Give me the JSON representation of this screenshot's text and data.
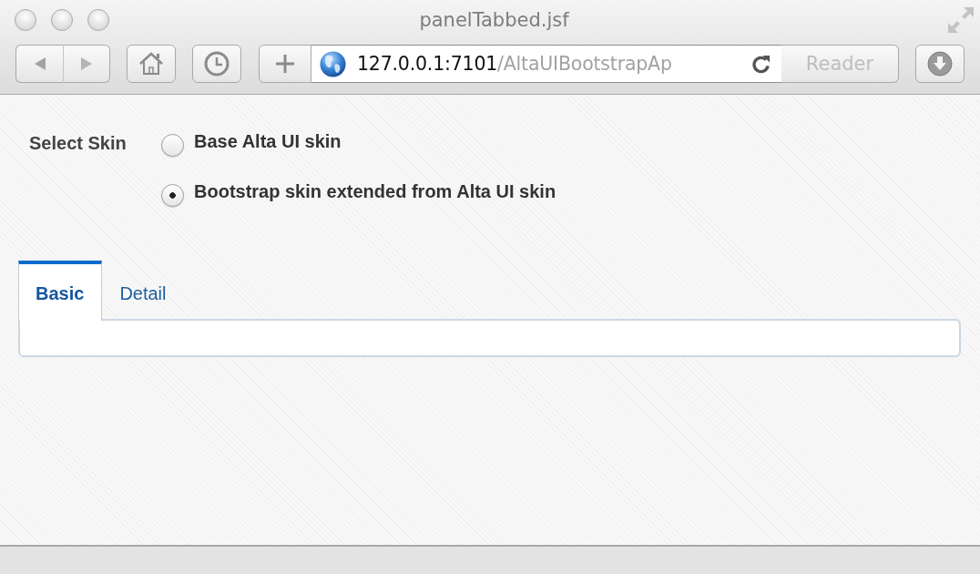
{
  "window": {
    "title": "panelTabbed.jsf"
  },
  "toolbar": {
    "address": {
      "host": "127.0.0.1:7101",
      "path": "/AltaUIBootstrapAp"
    },
    "reader_button": {
      "label": "Reader",
      "disabled": true
    }
  },
  "skin_selector": {
    "label": "Select Skin",
    "options": [
      {
        "label": "Base Alta UI skin",
        "selected": false
      },
      {
        "label": "Bootstrap skin extended from Alta UI skin",
        "selected": true
      }
    ]
  },
  "tabs": [
    {
      "label": "Basic",
      "selected": true
    },
    {
      "label": "Detail",
      "selected": false
    }
  ]
}
